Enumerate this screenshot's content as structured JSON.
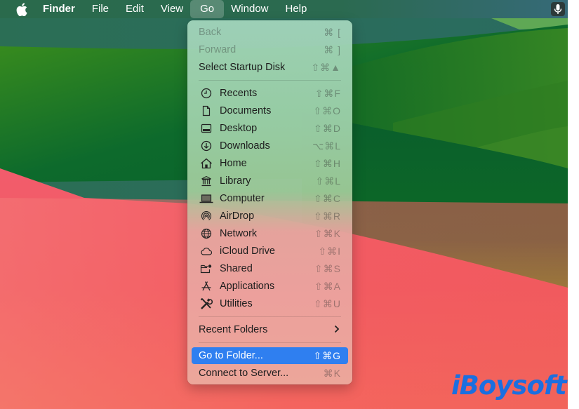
{
  "menubar": {
    "apple_icon": "apple-logo-icon",
    "items": [
      {
        "label": "Finder",
        "bold": true
      },
      {
        "label": "File"
      },
      {
        "label": "Edit"
      },
      {
        "label": "View"
      },
      {
        "label": "Go",
        "active": true
      },
      {
        "label": "Window"
      },
      {
        "label": "Help"
      }
    ],
    "status_icon": "microphone-icon"
  },
  "go_menu": {
    "items": [
      {
        "label": "Back",
        "shortcut": "⌘ [",
        "disabled": true
      },
      {
        "label": "Forward",
        "shortcut": "⌘ ]",
        "disabled": true
      },
      {
        "label": "Select Startup Disk",
        "shortcut": "⇧⌘▲"
      },
      {
        "label": "Recents",
        "icon": "clock-icon",
        "shortcut": "⇧⌘F"
      },
      {
        "label": "Documents",
        "icon": "document-icon",
        "shortcut": "⇧⌘O"
      },
      {
        "label": "Desktop",
        "icon": "desktop-icon",
        "shortcut": "⇧⌘D"
      },
      {
        "label": "Downloads",
        "icon": "download-icon",
        "shortcut": "⌥⌘L"
      },
      {
        "label": "Home",
        "icon": "house-icon",
        "shortcut": "⇧⌘H"
      },
      {
        "label": "Library",
        "icon": "library-icon",
        "shortcut": "⇧⌘L"
      },
      {
        "label": "Computer",
        "icon": "laptop-icon",
        "shortcut": "⇧⌘C"
      },
      {
        "label": "AirDrop",
        "icon": "airdrop-icon",
        "shortcut": "⇧⌘R"
      },
      {
        "label": "Network",
        "icon": "globe-icon",
        "shortcut": "⇧⌘K"
      },
      {
        "label": "iCloud Drive",
        "icon": "cloud-icon",
        "shortcut": "⇧⌘I"
      },
      {
        "label": "Shared",
        "icon": "shared-folder-icon",
        "shortcut": "⇧⌘S"
      },
      {
        "label": "Applications",
        "icon": "app-store-icon",
        "shortcut": "⇧⌘A"
      },
      {
        "label": "Utilities",
        "icon": "tools-icon",
        "shortcut": "⇧⌘U"
      },
      {
        "label": "Recent Folders",
        "submenu": true
      },
      {
        "label": "Go to Folder...",
        "shortcut": "⇧⌘G",
        "highlighted": true
      },
      {
        "label": "Connect to Server...",
        "shortcut": "⌘K"
      }
    ]
  },
  "watermark": {
    "text": "iBoysoft"
  },
  "colors": {
    "highlight": "#2f7ff0",
    "watermark": "#1b6fe0"
  }
}
